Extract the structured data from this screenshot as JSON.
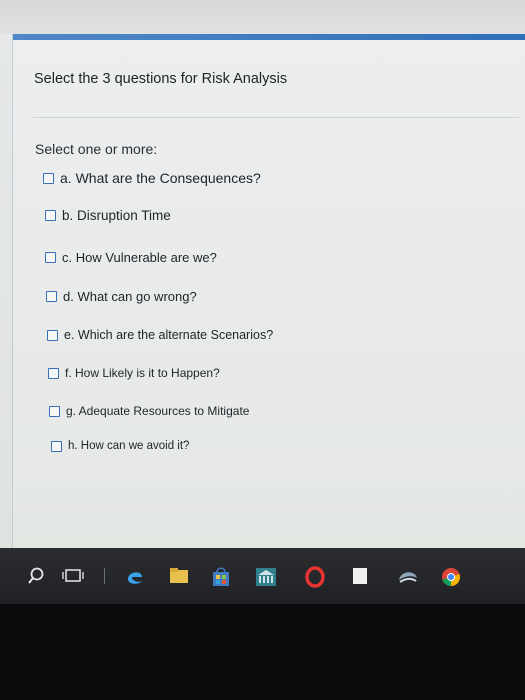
{
  "question": {
    "title": "Select the 3 questions for Risk Analysis",
    "prompt": "Select one or more:"
  },
  "options": [
    {
      "label": "a. What are the Consequences?"
    },
    {
      "label": "b. Disruption Time"
    },
    {
      "label": "c. How Vulnerable are we?"
    },
    {
      "label": "d. What can go wrong?"
    },
    {
      "label": "e. Which are the alternate Scenarios?"
    },
    {
      "label": "f. How Likely is it to Happen?"
    },
    {
      "label": "g. Adequate Resources to Mitigate"
    },
    {
      "label": "h. How can we avoid it?"
    }
  ],
  "taskbar": {
    "icons": [
      "search-icon",
      "task-view-icon",
      "edge-icon",
      "file-explorer-icon",
      "store-icon",
      "app-icon",
      "opera-icon",
      "app-icon-2",
      "app-icon-3",
      "chrome-icon"
    ]
  },
  "colors": {
    "accent": "#2f6fb9",
    "checkbox_border": "#3a6fb6",
    "taskbar": "#202225"
  }
}
